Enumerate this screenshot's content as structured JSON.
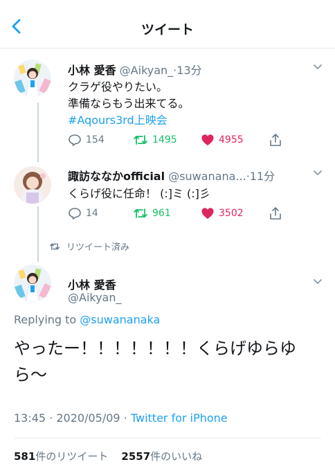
{
  "header": {
    "title": "ツイート"
  },
  "tweet1": {
    "name": "小林 愛香",
    "handle": "@Aikyan_",
    "time": "·13分",
    "lines": [
      "クラゲ役やりたい。",
      "準備ならもう出来てる。"
    ],
    "hashtag": "#Aqours3rd上映会",
    "replies": "154",
    "retweets": "1495",
    "likes": "4955"
  },
  "tweet2": {
    "name": "諏訪ななかofficial",
    "handle": "@suwanana...",
    "time": "·11分",
    "text": "くらげ役に任命！ (:]ミ (:]彡",
    "replies": "14",
    "retweets": "961",
    "likes": "3502"
  },
  "retweet_indicator": "リツイート済み",
  "main_tweet": {
    "name": "小林 愛香",
    "handle": "@Aikyan_",
    "replying_prefix": "Replying to",
    "replying_to": "@suwananaka",
    "text_line1": "やったー！！！！！！！くらげゆらゆ",
    "text_line2": "ら〜",
    "timestamp": "13:45 · 2020/05/09 ·",
    "source": "Twitter for iPhone",
    "retweet_count": "581",
    "retweet_label": "件のリツイート",
    "like_count": "2557",
    "like_label": "件のいいね"
  },
  "colors": {
    "accent": "#1da1f2",
    "retweet": "#17bf63",
    "like": "#e0245e",
    "muted": "#657786"
  }
}
